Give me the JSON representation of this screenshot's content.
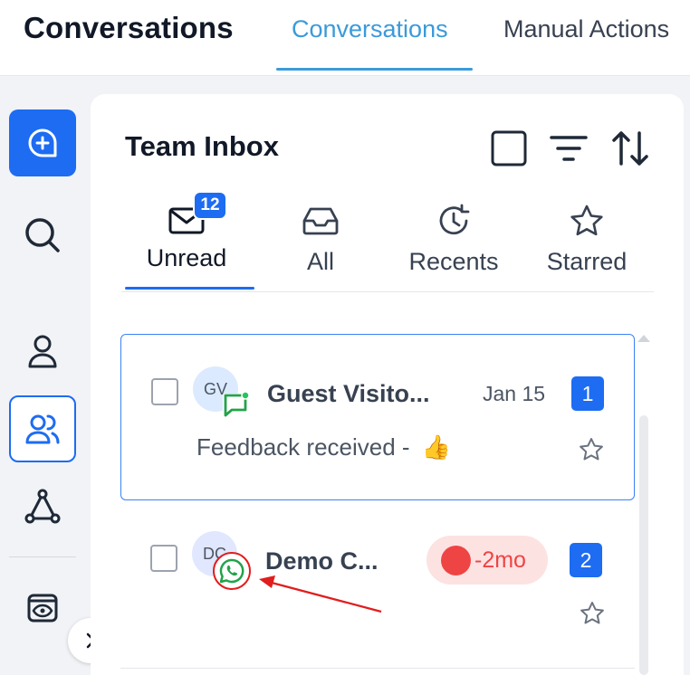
{
  "header": {
    "app_title": "Conversations",
    "tabs": [
      {
        "label": "Conversations",
        "active": true
      },
      {
        "label": "Manual Actions",
        "active": false
      }
    ]
  },
  "sidebar": {
    "items": [
      {
        "icon": "new-chat-icon"
      },
      {
        "icon": "search-icon"
      },
      {
        "icon": "user-icon"
      },
      {
        "icon": "users-icon",
        "selected": true
      },
      {
        "icon": "network-icon"
      },
      {
        "icon": "eye-icon"
      }
    ],
    "expand_icon": "chevron-right-icon"
  },
  "inbox": {
    "title": "Team Inbox",
    "header_icons": [
      "checkbox-icon",
      "filter-icon",
      "sort-icon"
    ],
    "filter_tabs": [
      {
        "label": "Unread",
        "icon": "mail-icon",
        "badge": "12",
        "active": true
      },
      {
        "label": "All",
        "icon": "inbox-icon"
      },
      {
        "label": "Recents",
        "icon": "history-icon"
      },
      {
        "label": "Starred",
        "icon": "star-icon"
      }
    ],
    "conversations": [
      {
        "initials": "GV",
        "name": "Guest Visito...",
        "date": "Jan 15",
        "unread": "1",
        "preview": "Feedback received -",
        "preview_emoji": "👍",
        "channel_icon": "sms-icon"
      },
      {
        "initials": "DC",
        "name": "Demo C...",
        "overdue": "-2mo",
        "unread": "2",
        "channel_icon": "whatsapp-icon"
      }
    ]
  },
  "colors": {
    "accent": "#1d6cf2",
    "tab_active": "#3b9ad9",
    "overdue_bg": "#fde2e2",
    "overdue_text": "#ef4444",
    "annotation": "#e11d1d"
  }
}
